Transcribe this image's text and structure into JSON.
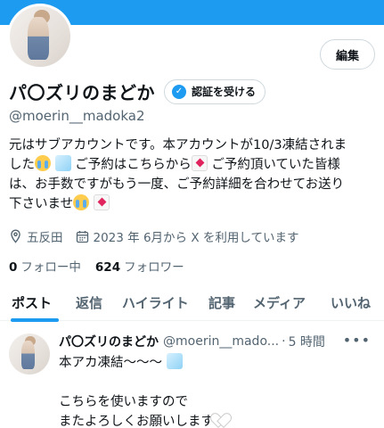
{
  "profile": {
    "display_name": "パ〇ズリのまどか",
    "verify_button": "認証を受ける",
    "edit_button": "編集",
    "handle": "@moerin__madoka2",
    "bio": {
      "line1": "元はサブアカウントです。本アカウントが10/3凍結されま",
      "line2a": "した",
      "line2b": "ご予約はこちらから",
      "line2c": "ご予約頂いていた皆様",
      "line3": "は、お手数ですがもう一度、ご予約詳細を合わせてお送り",
      "line4": "下さいませ"
    },
    "location": "五反田",
    "joined": "2023 年 6月から X を利用しています",
    "following_count": "0",
    "following_label": "フォロー中",
    "followers_count": "624",
    "followers_label": "フォロワー"
  },
  "tabs": [
    "ポスト",
    "返信",
    "ハイライト",
    "記事",
    "メディア",
    "いいね"
  ],
  "post": {
    "name": "パ〇ズリのまどか",
    "handle": "@moerin__mado...",
    "dot": "·",
    "time": "5 時間",
    "line1": "本アカ凍結〜〜〜",
    "line2": "こちらを使いますので",
    "line3": "またよろしくお願いします"
  },
  "colors": {
    "accent": "#1d9bf0",
    "text": "#0f1419",
    "secondary": "#536471"
  },
  "icons": [
    "location-icon",
    "calendar-icon",
    "verified-badge-icon",
    "more-icon"
  ]
}
